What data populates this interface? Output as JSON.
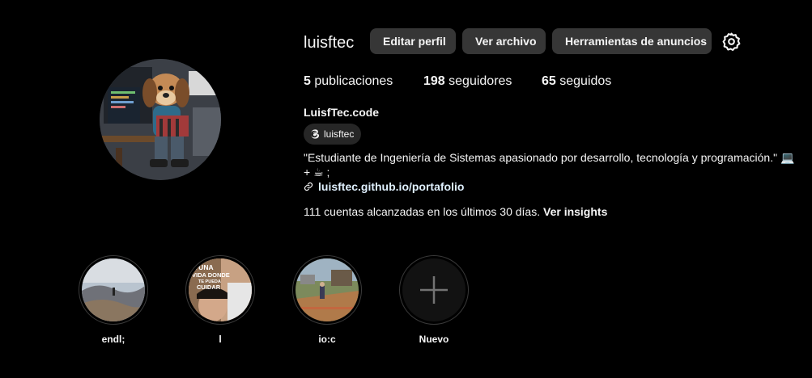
{
  "profile": {
    "username": "luisftec",
    "display_name": "LuisfTec.code",
    "threads_handle": "luisftec",
    "bio": "\"Estudiante de Ingeniería de Sistemas apasionado por desarrollo, tecnología y programación.\" 💻 + ☕ ;",
    "link": "luisftec.github.io/portafolio"
  },
  "actions": {
    "edit_profile": "Editar perfil",
    "view_archive": "Ver archivo",
    "ad_tools": "Herramientas de anuncios"
  },
  "stats": {
    "posts_count": "5",
    "posts_label": " publicaciones",
    "followers_count": "198",
    "followers_label": " seguidores",
    "following_count": "65",
    "following_label": " seguidos"
  },
  "insights": {
    "text": "111 cuentas alcanzadas en los últimos 30 días. ",
    "link": "Ver insights"
  },
  "highlights": [
    {
      "label": "endl;"
    },
    {
      "label": "l"
    },
    {
      "label": "io:c"
    },
    {
      "label": "Nuevo"
    }
  ],
  "highlight_thumbnail_text": {
    "line1": "A UNA",
    "line2": "VIDA DONDE",
    "line3": "TE PUEDA",
    "line4": "CUIDAR"
  },
  "icons": {
    "settings": "gear-icon",
    "threads": "threads-icon",
    "link": "link-icon",
    "new_highlight": "plus-icon"
  },
  "colors": {
    "background": "#000000",
    "button_bg": "#363636",
    "text": "#f5f5f5",
    "pill_bg": "#262626"
  }
}
